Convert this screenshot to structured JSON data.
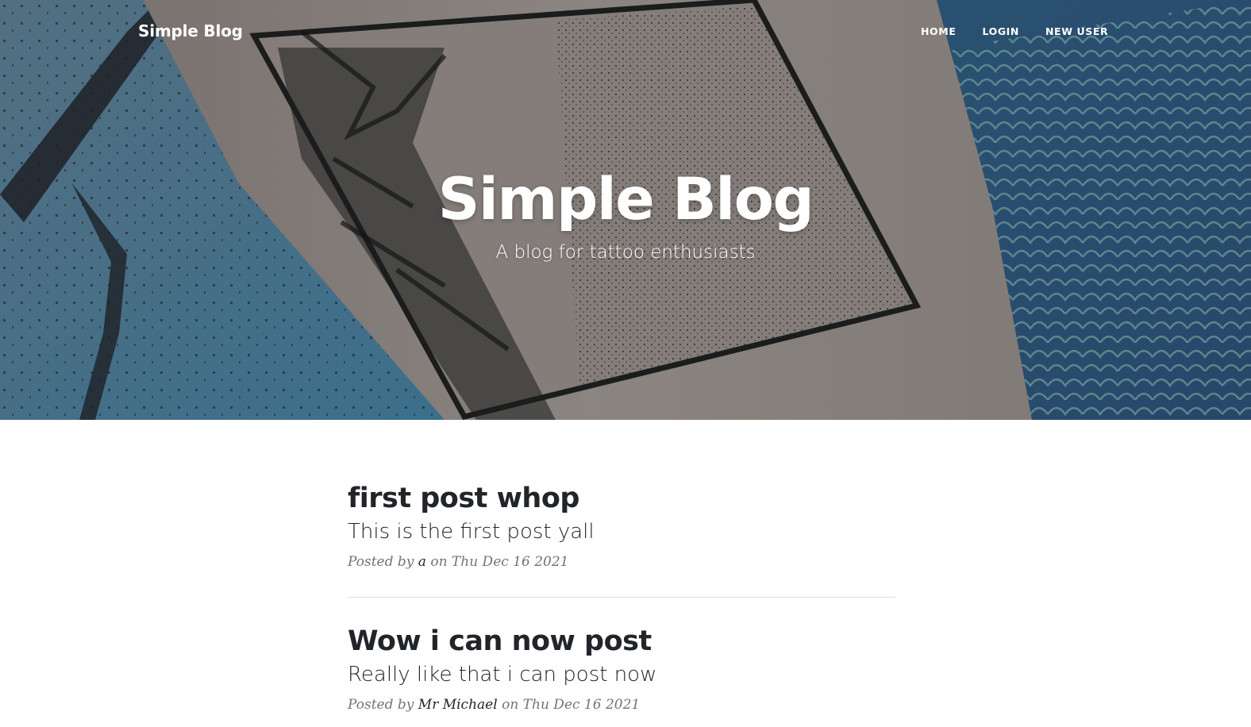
{
  "navbar": {
    "brand": "Simple Blog",
    "links": [
      "HOME",
      "LOGIN",
      "NEW USER"
    ]
  },
  "header": {
    "title": "Simple Blog",
    "subtitle": "A blog for tattoo enthusiasts"
  },
  "posts": [
    {
      "title": "first post whop",
      "subtitle": "This is the first post yall",
      "meta_prefix": "Posted by",
      "author": "a",
      "meta_mid": "on",
      "date": "Thu Dec 16 2021"
    },
    {
      "title": "Wow i can now post",
      "subtitle": "Really like that i can post now",
      "meta_prefix": "Posted by",
      "author": "Mr Michael",
      "meta_mid": "on",
      "date": "Thu Dec 16 2021"
    }
  ]
}
